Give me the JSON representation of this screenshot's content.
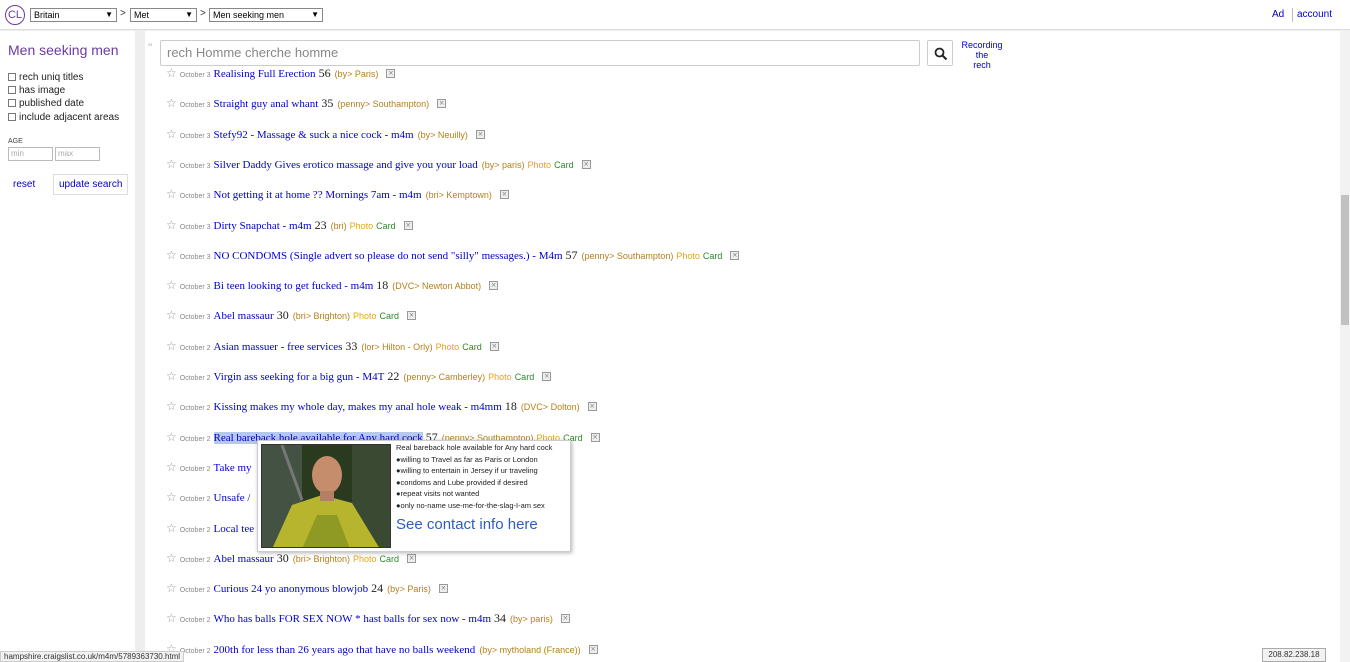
{
  "header": {
    "logo": "CL",
    "breadcrumb": [
      {
        "value": "Britain"
      },
      {
        "value": "Met"
      },
      {
        "value": "Men seeking men"
      }
    ],
    "separator": ">",
    "links": {
      "ad": "Ad",
      "account": "account"
    }
  },
  "sidebar": {
    "title": "Men seeking men",
    "filters": [
      {
        "label": "rech uniq titles",
        "checked": false
      },
      {
        "label": "has image",
        "checked": false
      },
      {
        "label": "published date",
        "checked": false
      },
      {
        "label": "include adjacent areas",
        "checked": false
      }
    ],
    "age_label": "AGE",
    "min_placeholder": "min",
    "max_placeholder": "max",
    "reset_label": "reset",
    "update_label": "update search"
  },
  "search": {
    "quote": "\"",
    "placeholder": "rech Homme cherche homme",
    "recording_line1": "Recording",
    "recording_line2": "the",
    "recording_line3": "rech"
  },
  "listings": [
    {
      "date": "October 3",
      "title": "Realising Full Erection",
      "age": "56",
      "loc": "(by> Paris)",
      "photo": "",
      "card": ""
    },
    {
      "date": "October 3",
      "title": "Straight guy anal whant",
      "age": "35",
      "loc": "(penny> Southampton)",
      "photo": "",
      "card": ""
    },
    {
      "date": "October 3",
      "title": "Stefy92 - Massage & suck a nice cock - m4m",
      "age": "",
      "loc": "(by> Neuilly)",
      "photo": "",
      "card": ""
    },
    {
      "date": "October 3",
      "title": "Silver Daddy Gives erotico massage and give you your load",
      "age": "",
      "loc": "(by> paris)",
      "photo": "Photo",
      "card": "Card"
    },
    {
      "date": "October 3",
      "title": "Not getting it at home ?? Mornings 7am - m4m",
      "age": "",
      "loc": "(bri> Kemptown)",
      "photo": "",
      "card": ""
    },
    {
      "date": "October 3",
      "title": "Dirty Snapchat - m4m",
      "age": "23",
      "loc": "(bri)",
      "photo": "Photo",
      "card": "Card"
    },
    {
      "date": "October 3",
      "title": "NO CONDOMS (Single advert so please do not send \"silly\" messages.) - M4m",
      "age": "57",
      "loc": "(penny> Southampton)",
      "photo": "Photo",
      "card": "Card"
    },
    {
      "date": "October 3",
      "title": "Bi teen looking to get fucked - m4m",
      "age": "18",
      "loc": "(DVC> Newton Abbot)",
      "photo": "",
      "card": ""
    },
    {
      "date": "October 3",
      "title": "Abel massaur",
      "age": "30",
      "loc": "(bri> Brighton)",
      "photo": "Photo",
      "card": "Card"
    },
    {
      "date": "October 2",
      "title": "Asian massuer - free services",
      "age": "33",
      "loc": "(lor> Hilton - Orly)",
      "photo": "Photo",
      "card": "Card"
    },
    {
      "date": "October 2",
      "title": "Virgin ass seeking for a big gun - M4T",
      "age": "22",
      "loc": "(penny> Camberley)",
      "photo": "Photo",
      "card": "Card"
    },
    {
      "date": "October 2",
      "title": "Kissing makes my whole day, makes my anal hole weak - m4mm",
      "age": "18",
      "loc": "(DVC> Dolton)",
      "photo": "",
      "card": ""
    },
    {
      "date": "October 2",
      "title": "Real bareback hole available for Any hard cock",
      "age": "57",
      "loc": "(penny> Southampton)",
      "photo": "Photo",
      "card": "Card"
    },
    {
      "date": "October 2",
      "title": "Take my",
      "age": "",
      "loc": "",
      "photo": "",
      "card": ""
    },
    {
      "date": "October 2",
      "title": "Unsafe /",
      "age": "",
      "loc": "",
      "photo": "",
      "card": ""
    },
    {
      "date": "October 2",
      "title": "Local tee",
      "age": "",
      "loc": "",
      "photo": "",
      "card": ""
    },
    {
      "date": "October 2",
      "title": "Abel massaur",
      "age": "30",
      "loc": "(bri> Brighton)",
      "photo": "Photo",
      "card": "Card"
    },
    {
      "date": "October 2",
      "title": "Curious 24 yo anonymous blowjob",
      "age": "24",
      "loc": "(by> Paris)",
      "photo": "",
      "card": ""
    },
    {
      "date": "October 2",
      "title": "Who has balls FOR SEX NOW * hast balls for sex now - m4m",
      "age": "34",
      "loc": "(by> paris)",
      "photo": "",
      "card": ""
    },
    {
      "date": "October 2",
      "title": "200th for less than 26 years ago that have no balls weekend",
      "age": "",
      "loc": "(by> mytholand (France))",
      "photo": "",
      "card": ""
    }
  ],
  "popup": {
    "lines": [
      "Real bareback hole available for Any hard cock",
      "●willing to Travel as far as Paris or London",
      "●willing to entertain in Jersey if ur traveling",
      "●condoms and Lube provided if desired",
      "●repeat visits not wanted",
      "●only no-name use-me-for-the-slag-I-am sex"
    ],
    "contact": "See contact info here"
  },
  "status": {
    "url": "hampshire.craigslist.co.uk/m4m/5789363730.html",
    "ip": "208.82.238.18"
  }
}
